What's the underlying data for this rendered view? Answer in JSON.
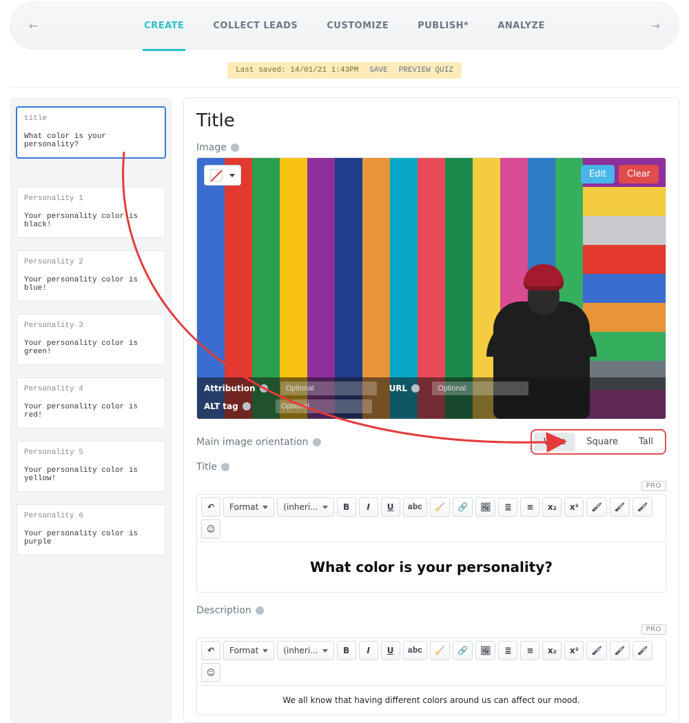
{
  "nav": {
    "tabs": [
      "CREATE",
      "COLLECT LEADS",
      "CUSTOMIZE",
      "PUBLISH*",
      "ANALYZE"
    ],
    "active_index": 0
  },
  "save_bar": {
    "last_saved": "Last saved: 14/01/21 1:43PM",
    "save_label": "SAVE",
    "preview_label": "PREVIEW QUIZ"
  },
  "sidebar": {
    "title_card": {
      "label": "title",
      "text": "What color is your personality?"
    },
    "items": [
      {
        "label": "Personality 1",
        "text": "Your personality color is black!"
      },
      {
        "label": "Personality 2",
        "text": "Your personality color is blue!"
      },
      {
        "label": "Personality 3",
        "text": "Your personality color is green!"
      },
      {
        "label": "Personality 4",
        "text": "Your personality color is red!"
      },
      {
        "label": "Personality 5",
        "text": "Your personality color is yellow!"
      },
      {
        "label": "Personality 6",
        "text": "Your personality color is purple"
      }
    ]
  },
  "main": {
    "heading": "Title",
    "image_section_label": "Image",
    "edit_label": "Edit",
    "clear_label": "Clear",
    "attribution_label": "Attribution",
    "url_label": "URL",
    "alt_label": "ALT tag",
    "optional_placeholder": "Optional",
    "orientation_label": "Main image orientation",
    "orientation_options": [
      "Wide",
      "Square",
      "Tall"
    ],
    "orientation_active_index": 0,
    "title_section_label": "Title",
    "description_section_label": "Description",
    "pro_badge": "PRO",
    "title_value": "What color is your personality?",
    "description_value": "We all know that having different colors around us can affect our mood.",
    "toolbar": {
      "format": "Format",
      "font": "(inheri..."
    }
  }
}
